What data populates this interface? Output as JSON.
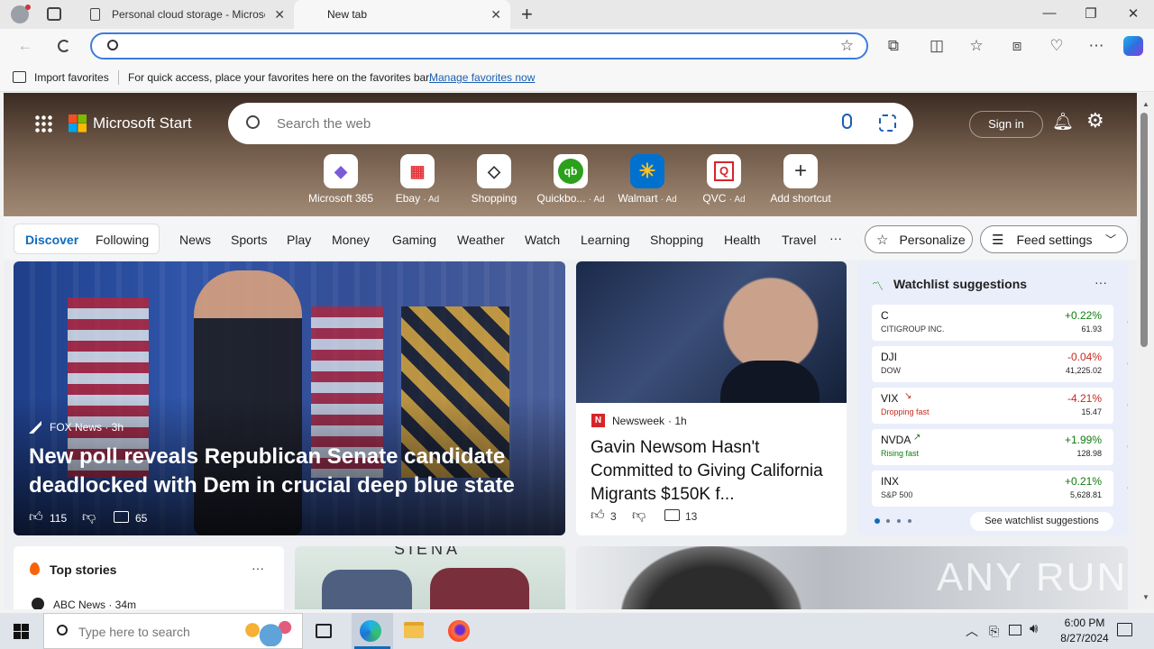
{
  "browser": {
    "tabs": [
      {
        "title": "Personal cloud storage - Microsc",
        "close": "✕"
      },
      {
        "title": "New tab",
        "close": "✕"
      }
    ],
    "new_tab": "+",
    "address": {
      "value": "",
      "placeholder": ""
    },
    "favorites_bar": {
      "import": "Import favorites",
      "message": "For quick access, place your favorites here on the favorites bar.",
      "link": "Manage favorites now"
    }
  },
  "ms_start": {
    "brand": "Microsoft Start",
    "search_placeholder": "Search the web",
    "sign_in": "Sign in",
    "shortcuts": [
      {
        "label": "Microsoft 365",
        "ad": "",
        "glyph": "◆",
        "color": "#7b5cd6"
      },
      {
        "label": "Ebay",
        "ad": "· Ad",
        "glyph": "▦",
        "color": "#e53238"
      },
      {
        "label": "Shopping",
        "ad": "",
        "glyph": "◇",
        "color": "#333333"
      },
      {
        "label": "Quickbo...",
        "ad": "· Ad",
        "glyph": "qb",
        "color": "#2ca01c"
      },
      {
        "label": "Walmart",
        "ad": "· Ad",
        "glyph": "✳",
        "color": "#0071ce"
      },
      {
        "label": "QVC",
        "ad": "· Ad",
        "glyph": "Q",
        "color": "#d7242a"
      },
      {
        "label": "Add shortcut",
        "ad": "",
        "glyph": "+",
        "color": "#333333"
      }
    ],
    "tabs": {
      "discover": "Discover",
      "following": "Following"
    },
    "categories": [
      "News",
      "Sports",
      "Play",
      "Money",
      "Gaming",
      "Weather",
      "Watch",
      "Learning",
      "Shopping",
      "Health",
      "Travel",
      "···"
    ],
    "personalize": "Personalize",
    "feed_settings": "Feed settings",
    "big_story": {
      "source": "FOX News · 3h",
      "headline": "New poll reveals Republican Senate candidate deadlocked with Dem in crucial deep blue state",
      "likes": "115",
      "comments": "65"
    },
    "mid_story": {
      "source": "Newsweek",
      "age": "· 1h",
      "headline": "Gavin Newsom Hasn't Committed to Giving California Migrants $150K f...",
      "likes": "3",
      "comments": "13"
    },
    "watchlist": {
      "title": "Watchlist suggestions",
      "more": "···",
      "stocks": [
        {
          "symbol": "C",
          "name": "CITIGROUP INC.",
          "change": "+0.22%",
          "price": "61.93",
          "dir": "up",
          "tag": ""
        },
        {
          "symbol": "DJI",
          "name": "DOW",
          "change": "-0.04%",
          "price": "41,225.02",
          "dir": "dn",
          "tag": ""
        },
        {
          "symbol": "VIX",
          "name": "Dropping fast",
          "change": "-4.21%",
          "price": "15.47",
          "dir": "dn",
          "tag": "dn"
        },
        {
          "symbol": "NVDA",
          "name": "Rising fast",
          "change": "+1.99%",
          "price": "128.98",
          "dir": "up",
          "tag": "up"
        },
        {
          "symbol": "INX",
          "name": "S&P 500",
          "change": "+0.21%",
          "price": "5,628.81",
          "dir": "up",
          "tag": ""
        }
      ],
      "see_more": "See watchlist suggestions"
    },
    "top_stories": {
      "title": "Top stories",
      "more": "···",
      "source": "ABC News · 34m"
    },
    "ad_card_text": "SIENA",
    "watermark": "ANY RUN"
  },
  "taskbar": {
    "search_placeholder": "Type here to search",
    "time": "6:00 PM",
    "date": "8/27/2024"
  }
}
